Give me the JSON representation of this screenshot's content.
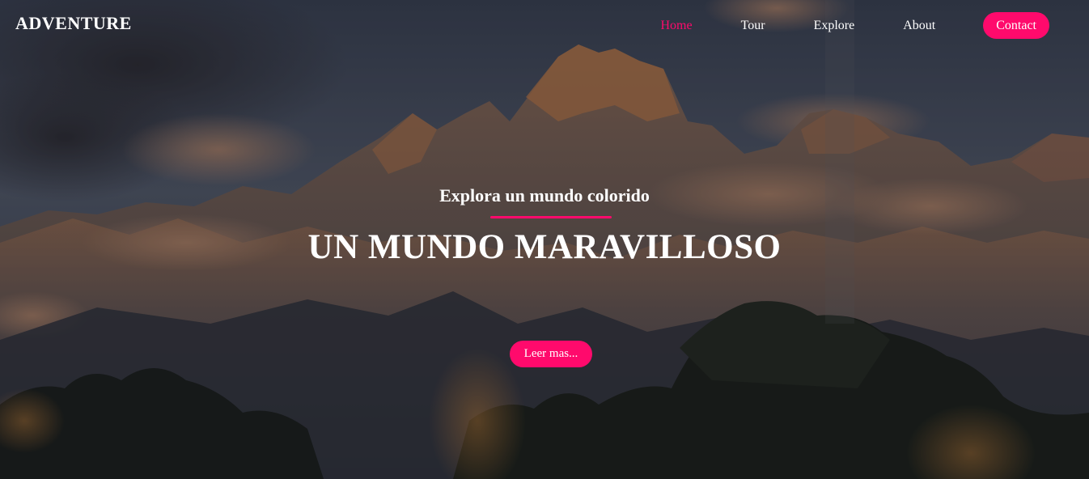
{
  "brand": {
    "name": "ADVENTURE"
  },
  "nav": {
    "items": [
      {
        "label": "Home",
        "active": true
      },
      {
        "label": "Tour",
        "active": false
      },
      {
        "label": "Explore",
        "active": false
      },
      {
        "label": "About",
        "active": false
      }
    ],
    "contact_label": "Contact"
  },
  "hero": {
    "kicker": "Explora un mundo colorido",
    "headline": "UN MUNDO MARAVILLOSO",
    "cta_label": "Leer mas..."
  },
  "colors": {
    "accent": "#ff0a6c",
    "text": "#ffffff"
  },
  "icons": {
    "background": "mountain-landscape-photo"
  }
}
